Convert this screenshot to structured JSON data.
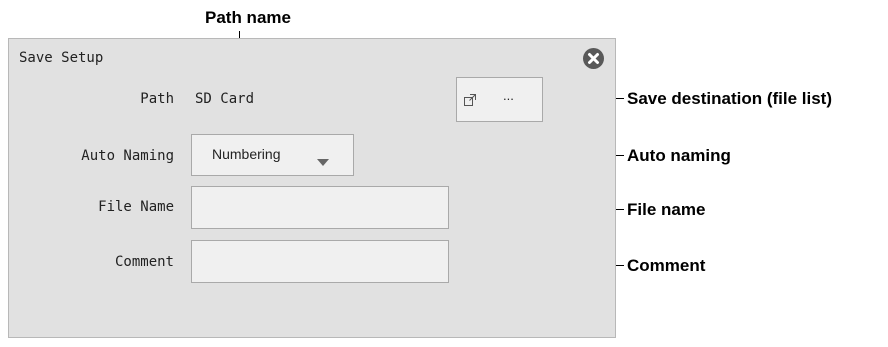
{
  "dialog": {
    "title": "Save Setup",
    "close_icon": "close-circle-icon",
    "path": {
      "label": "Path",
      "value": "SD Card"
    },
    "browse": {
      "icon": "external-open-icon",
      "label": "..."
    },
    "auto_naming": {
      "label": "Auto Naming",
      "selected": "Numbering"
    },
    "file_name": {
      "label": "File Name",
      "value": ""
    },
    "comment": {
      "label": "Comment",
      "value": ""
    }
  },
  "annotations": {
    "path_name": "Path name",
    "save_destination": "Save destination (file list)",
    "auto_naming": "Auto naming",
    "file_name": "File name",
    "comment": "Comment"
  }
}
